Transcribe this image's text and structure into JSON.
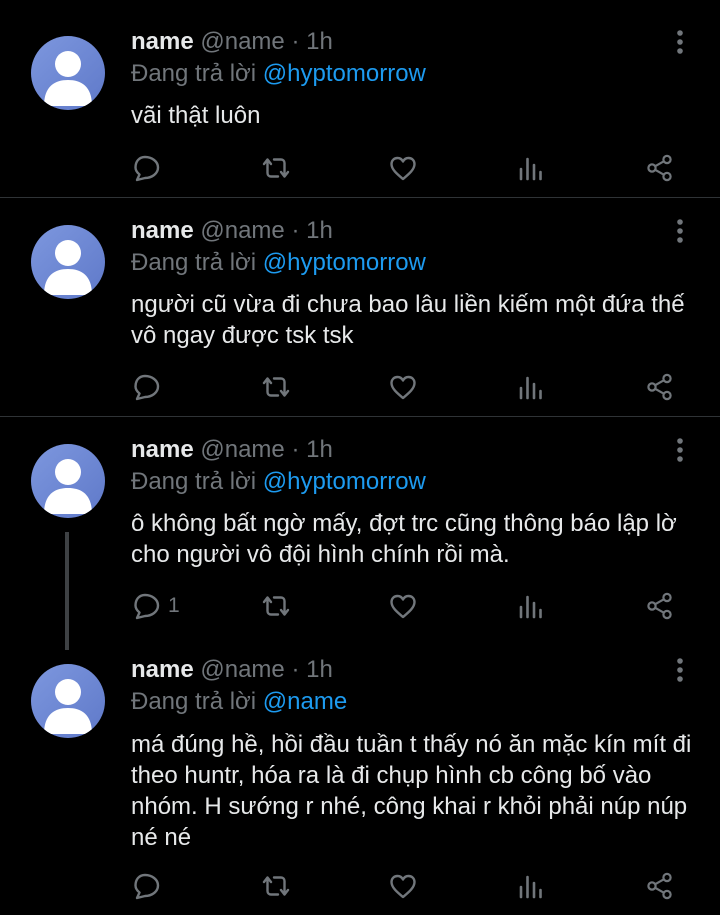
{
  "tweets": [
    {
      "author_name": "name",
      "handle": "@name",
      "time": "· 1h",
      "reply_prefix": "Đang trả lời",
      "reply_to": "@hyptomorrow",
      "text": "vãi thật luôn",
      "reply_count": ""
    },
    {
      "author_name": "name",
      "handle": "@name",
      "time": "· 1h",
      "reply_prefix": "Đang trả lời",
      "reply_to": "@hyptomorrow",
      "text": "người cũ vừa đi chưa bao lâu liền kiếm một đứa thế vô ngay được tsk tsk",
      "reply_count": ""
    },
    {
      "author_name": "name",
      "handle": "@name",
      "time": "· 1h",
      "reply_prefix": "Đang trả lời",
      "reply_to": "@hyptomorrow",
      "text": "ô không bất ngờ mấy, đợt trc cũng thông báo lập lờ cho người vô đội hình chính rồi mà.",
      "reply_count": "1"
    },
    {
      "author_name": "name",
      "handle": "@name",
      "time": "· 1h",
      "reply_prefix": "Đang trả lời",
      "reply_to": "@name",
      "text": "má đúng hề, hồi đầu tuần t thấy nó ăn mặc kín mít đi theo huntr, hóa ra là đi chụp hình cb công bố vào nhóm. H sướng r nhé, công khai r khỏi phải núp núp né né",
      "reply_count": ""
    }
  ],
  "icons": {
    "avatar": "default-avatar-icon",
    "more": "more-vertical-icon",
    "reply": "reply-icon",
    "retweet": "retweet-icon",
    "like": "heart-icon",
    "views": "analytics-icon",
    "share": "share-icon"
  },
  "colors": {
    "background": "#000000",
    "text": "#e7e9ea",
    "muted": "#71767b",
    "accent": "#1d9bf0",
    "avatar": "#6f88d4",
    "divider": "#2f3336"
  }
}
